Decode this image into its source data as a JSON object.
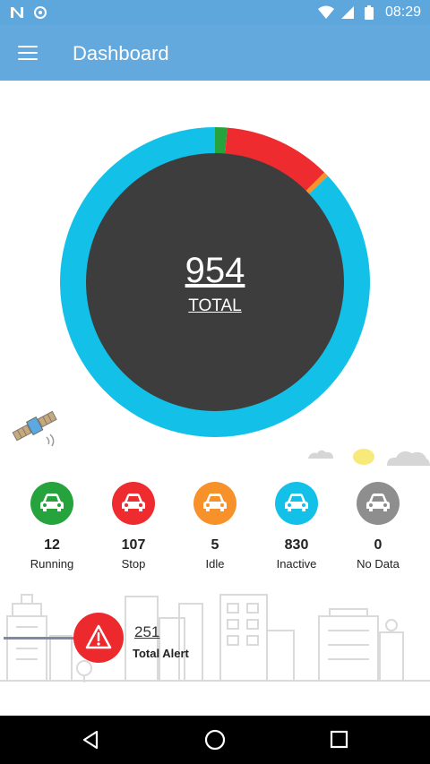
{
  "status_bar": {
    "time": "08:29",
    "icons": [
      "n-notification-icon",
      "shield-icon",
      "wifi-icon",
      "signal-icon",
      "battery-icon"
    ]
  },
  "app_bar": {
    "title": "Dashboard",
    "menu_icon": "menu-icon"
  },
  "summary": {
    "total": "954",
    "total_label": "TOTAL"
  },
  "chart_data": {
    "type": "pie",
    "categories": [
      "Running",
      "Stop",
      "Idle",
      "Inactive",
      "No Data"
    ],
    "values": [
      12,
      107,
      5,
      830,
      0
    ],
    "colors": [
      "#27a33d",
      "#ee2b2f",
      "#f7922b",
      "#13c1e8",
      "#7c7c7c"
    ]
  },
  "stats": [
    {
      "count": "12",
      "label": "Running",
      "color": "#27a33d",
      "icon": "car-icon"
    },
    {
      "count": "107",
      "label": "Stop",
      "color": "#ee2b2f",
      "icon": "car-icon"
    },
    {
      "count": "5",
      "label": "Idle",
      "color": "#f7922b",
      "icon": "car-icon"
    },
    {
      "count": "830",
      "label": "Inactive",
      "color": "#13c1e8",
      "icon": "car-icon"
    },
    {
      "count": "0",
      "label": "No Data",
      "color": "#8e8e8e",
      "icon": "car-icon"
    }
  ],
  "alert": {
    "count": "251",
    "label": "Total Alert",
    "icon": "warning-icon",
    "color": "#ec2a2e"
  },
  "nav_bar": {
    "buttons": [
      "back-icon",
      "home-icon",
      "recents-icon"
    ]
  }
}
